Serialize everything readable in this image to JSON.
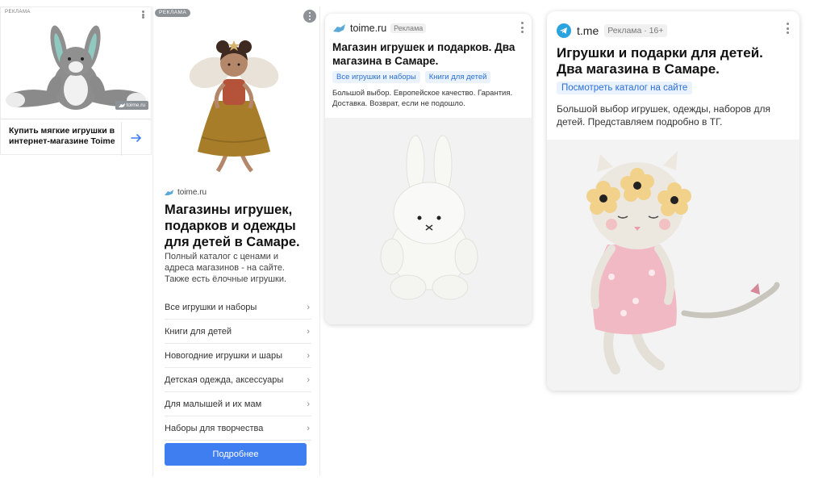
{
  "colors": {
    "accent_blue": "#3f7ef0",
    "link_blue": "#2a6fd6",
    "badge_gray": "#8d9297",
    "telegram_blue": "#2aa3df"
  },
  "card1": {
    "ad_label": "РЕКЛАМА",
    "source_badge": "toime.ru",
    "title": "Купить мягкие игрушки в интернет-магазине Toime",
    "image_subject": "plush grey bunny toy",
    "arrow_icon": "arrow-right-icon"
  },
  "card2": {
    "ad_badge": "РЕКЛАМА",
    "image_subject": "fairy doll with wings",
    "domain": "toime.ru",
    "title": "Магазины игрушек, подарков и одежды для детей в Самаре.",
    "description": "Полный каталог с ценами и адреса магазинов - на сайте. Также есть ёлочные игрушки.",
    "links": [
      "Все игрушки и наборы",
      "Книги для детей",
      "Новогодние игрушки и шары",
      "Детская одежда, аксессуары",
      "Для малышей и их мам",
      "Наборы для творчества"
    ],
    "button_label": "Подробнее"
  },
  "card3": {
    "domain": "toime.ru",
    "ad_badge": "Реклама",
    "title": "Магазин игрушек и подарков. Два магазина в Самаре.",
    "chips": [
      "Все игрушки и наборы",
      "Книги для детей"
    ],
    "description": "Большой выбор. Европейское качество. Гарантия. Доставка. Возврат, если не подошло.",
    "image_subject": "white plush bunny"
  },
  "card4": {
    "domain": "t.me",
    "ad_badge": "Реклама · 16+",
    "title": "Игрушки и подарки для детей. Два магазина в Самаре.",
    "chip": "Посмотреть каталог на сайте",
    "description": "Большой выбор игрушек, одежды, наборов для детей. Представляем подробно в ТГ.",
    "image_subject": "plush cat doll in pink dress"
  }
}
